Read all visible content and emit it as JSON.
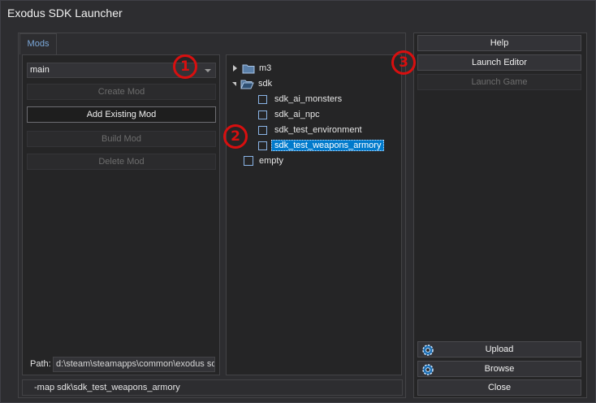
{
  "window": {
    "title": "Exodus SDK Launcher"
  },
  "tabs": [
    {
      "label": "Mods"
    }
  ],
  "mods_panel": {
    "selected_mod": "main",
    "buttons": {
      "create": "Create Mod",
      "add_existing": "Add Existing Mod",
      "build": "Build Mod",
      "delete": "Delete Mod"
    },
    "path_label": "Path:",
    "path_value": "d:\\steam\\steamapps\\common\\exodus sdk"
  },
  "tree": {
    "items": [
      {
        "label": "m3",
        "type": "folder",
        "expanded": false
      },
      {
        "label": "sdk",
        "type": "folder",
        "expanded": true
      },
      {
        "label": "sdk_ai_monsters",
        "type": "item",
        "checked": false
      },
      {
        "label": "sdk_ai_npc",
        "type": "item",
        "checked": false
      },
      {
        "label": "sdk_test_environment",
        "type": "item",
        "checked": false
      },
      {
        "label": "sdk_test_weapons_armory",
        "type": "item",
        "checked": false,
        "selected": true
      },
      {
        "label": "empty",
        "type": "item",
        "checked": false
      }
    ]
  },
  "command_line": "-map sdk\\sdk_test_weapons_armory",
  "right_panel": {
    "help": "Help",
    "launch_editor": "Launch Editor",
    "launch_game": "Launch Game",
    "upload": "Upload",
    "browse": "Browse",
    "close": "Close"
  },
  "annotations": [
    "1",
    "2",
    "3"
  ],
  "colors": {
    "background": "#2d2d30",
    "panel": "#252526",
    "selection": "#007acc",
    "tab_text": "#7aa7d8",
    "callout": "#d80f0f"
  },
  "icons": {
    "folder": "folder-icon",
    "gear": "gear-icon"
  }
}
